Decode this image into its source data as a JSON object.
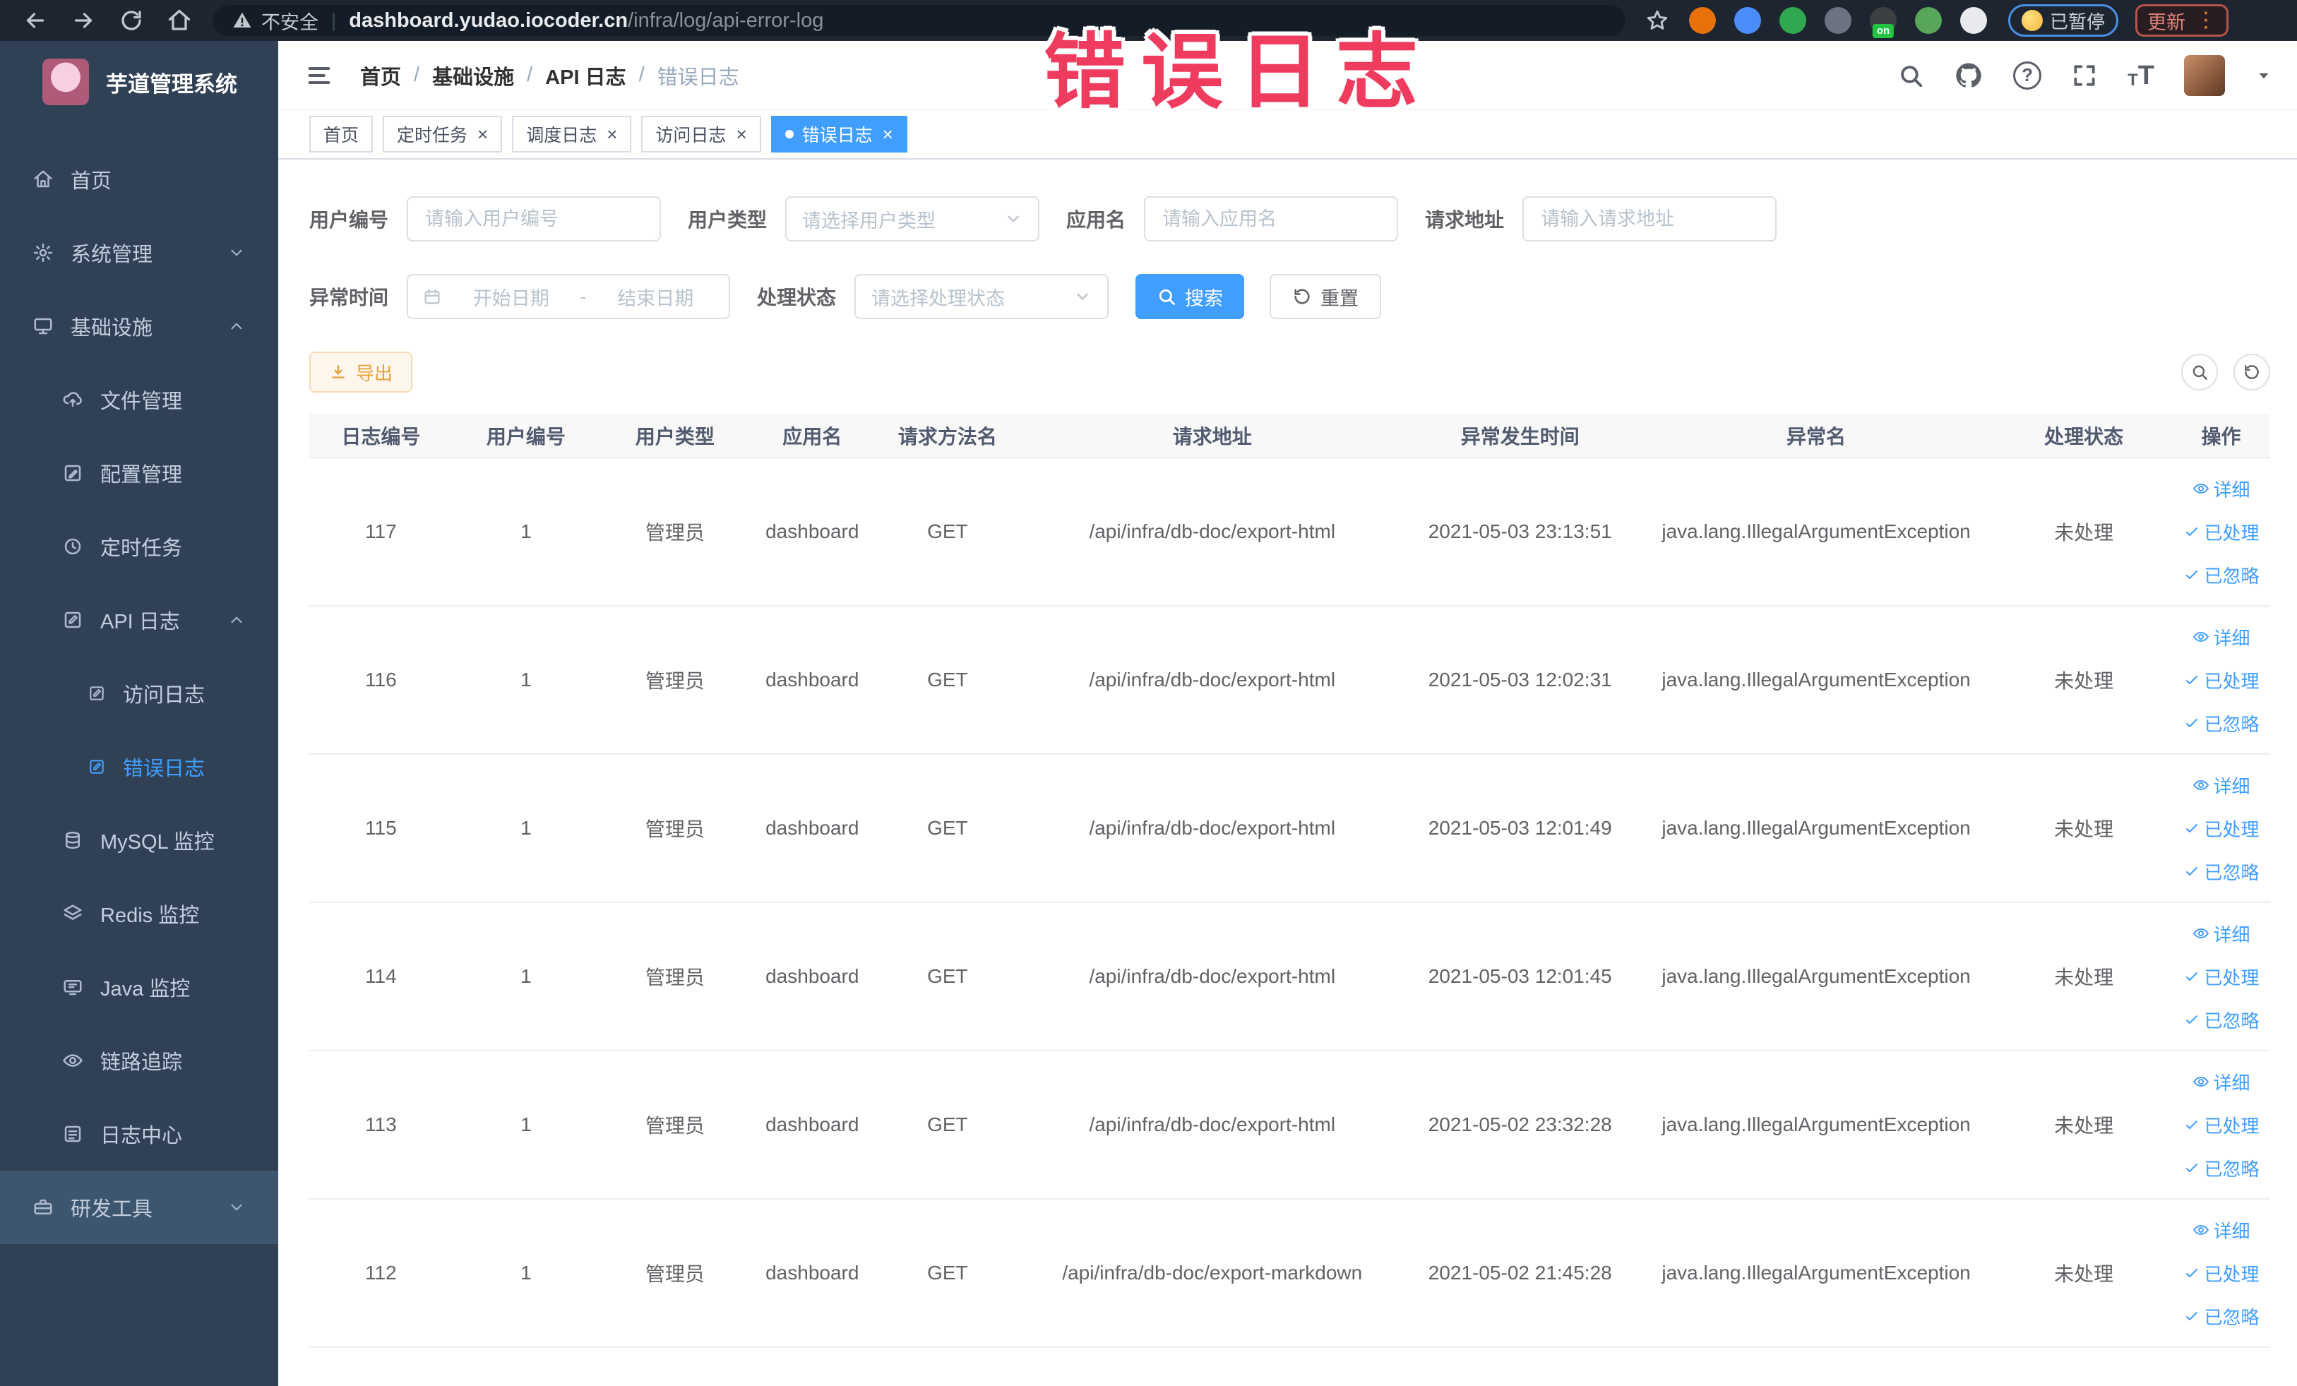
{
  "annotation": {
    "text": "错误日志",
    "color": "#ef3b5e"
  },
  "browser": {
    "security_label": "不安全",
    "url_host": "dashboard.yudao.iocoder.cn",
    "url_path": "/infra/log/api-error-log",
    "paused_label": "已暂停",
    "update_label": "更新",
    "extensions": [
      {
        "name": "orange-ring-extension-icon",
        "color": "#e8710a"
      },
      {
        "name": "blue-shield-extension-icon",
        "color": "#4b8df8"
      },
      {
        "name": "green-circle-extension-icon",
        "color": "#2fa84f"
      },
      {
        "name": "grid-extension-icon",
        "color": "#6b7380"
      },
      {
        "name": "proxy-extension-icon",
        "color": "#3c4043",
        "badge": "on"
      },
      {
        "name": "leaf-extension-icon",
        "color": "#57a65a"
      },
      {
        "name": "puzzle-extension-icon",
        "color": "#e9eaed"
      }
    ]
  },
  "sidebar": {
    "app_title": "芋道管理系统",
    "items": [
      {
        "label": "首页",
        "icon": "home-icon",
        "level": 0
      },
      {
        "label": "系统管理",
        "icon": "gear-icon",
        "level": 0,
        "chevron": "down"
      },
      {
        "label": "基础设施",
        "icon": "monitor-icon",
        "level": 0,
        "chevron": "up"
      },
      {
        "label": "文件管理",
        "icon": "cloud-upload-icon",
        "level": 1
      },
      {
        "label": "配置管理",
        "icon": "edit-icon",
        "level": 1
      },
      {
        "label": "定时任务",
        "icon": "clock-icon",
        "level": 1
      },
      {
        "label": "API 日志",
        "icon": "log-icon",
        "level": 1,
        "chevron": "up"
      },
      {
        "label": "访问日志",
        "icon": "log-icon",
        "level": 2
      },
      {
        "label": "错误日志",
        "icon": "log-icon",
        "level": 2,
        "active": true
      },
      {
        "label": "MySQL 监控",
        "icon": "database-icon",
        "level": 1
      },
      {
        "label": "Redis 监控",
        "icon": "layers-icon",
        "level": 1
      },
      {
        "label": "Java 监控",
        "icon": "java-monitor-icon",
        "level": 1
      },
      {
        "label": "链路追踪",
        "icon": "trace-icon",
        "level": 1
      },
      {
        "label": "日志中心",
        "icon": "log-center-icon",
        "level": 1
      },
      {
        "label": "研发工具",
        "icon": "toolbox-icon",
        "level": 0,
        "chevron": "down",
        "highlighted": true
      }
    ]
  },
  "header": {
    "breadcrumb": [
      "首页",
      "基础设施",
      "API 日志",
      "错误日志"
    ]
  },
  "tabs": [
    {
      "label": "首页",
      "closable": false,
      "active": false
    },
    {
      "label": "定时任务",
      "closable": true,
      "active": false
    },
    {
      "label": "调度日志",
      "closable": true,
      "active": false
    },
    {
      "label": "访问日志",
      "closable": true,
      "active": false
    },
    {
      "label": "错误日志",
      "closable": true,
      "active": true
    }
  ],
  "filters": {
    "user_id": {
      "label": "用户编号",
      "placeholder": "请输入用户编号"
    },
    "user_type": {
      "label": "用户类型",
      "placeholder": "请选择用户类型"
    },
    "app_name": {
      "label": "应用名",
      "placeholder": "请输入应用名"
    },
    "request_url": {
      "label": "请求地址",
      "placeholder": "请输入请求地址"
    },
    "exception_time": {
      "label": "异常时间",
      "start_placeholder": "开始日期",
      "separator": "-",
      "end_placeholder": "结束日期"
    },
    "process_status": {
      "label": "处理状态",
      "placeholder": "请选择处理状态"
    },
    "search_label": "搜索",
    "reset_label": "重置"
  },
  "toolbar": {
    "export_label": "导出"
  },
  "table": {
    "columns": [
      "日志编号",
      "用户编号",
      "用户类型",
      "应用名",
      "请求方法名",
      "请求地址",
      "异常发生时间",
      "异常名",
      "处理状态",
      "操作"
    ],
    "rows": [
      {
        "id": "117",
        "user_id": "1",
        "user_type": "管理员",
        "app_name": "dashboard",
        "method": "GET",
        "url": "/api/infra/db-doc/export-html",
        "time": "2021-05-03 23:13:51",
        "exception": "java.lang.IllegalArgumentException",
        "status": "未处理"
      },
      {
        "id": "116",
        "user_id": "1",
        "user_type": "管理员",
        "app_name": "dashboard",
        "method": "GET",
        "url": "/api/infra/db-doc/export-html",
        "time": "2021-05-03 12:02:31",
        "exception": "java.lang.IllegalArgumentException",
        "status": "未处理"
      },
      {
        "id": "115",
        "user_id": "1",
        "user_type": "管理员",
        "app_name": "dashboard",
        "method": "GET",
        "url": "/api/infra/db-doc/export-html",
        "time": "2021-05-03 12:01:49",
        "exception": "java.lang.IllegalArgumentException",
        "status": "未处理"
      },
      {
        "id": "114",
        "user_id": "1",
        "user_type": "管理员",
        "app_name": "dashboard",
        "method": "GET",
        "url": "/api/infra/db-doc/export-html",
        "time": "2021-05-03 12:01:45",
        "exception": "java.lang.IllegalArgumentException",
        "status": "未处理"
      },
      {
        "id": "113",
        "user_id": "1",
        "user_type": "管理员",
        "app_name": "dashboard",
        "method": "GET",
        "url": "/api/infra/db-doc/export-html",
        "time": "2021-05-02 23:32:28",
        "exception": "java.lang.IllegalArgumentException",
        "status": "未处理"
      },
      {
        "id": "112",
        "user_id": "1",
        "user_type": "管理员",
        "app_name": "dashboard",
        "method": "GET",
        "url": "/api/infra/db-doc/export-markdown",
        "time": "2021-05-02 21:45:28",
        "exception": "java.lang.IllegalArgumentException",
        "status": "未处理"
      }
    ],
    "row_actions": [
      {
        "label": "详细",
        "icon": "eye-icon"
      },
      {
        "label": "已处理",
        "icon": "check-icon"
      },
      {
        "label": "已忽略",
        "icon": "check-icon"
      }
    ]
  }
}
